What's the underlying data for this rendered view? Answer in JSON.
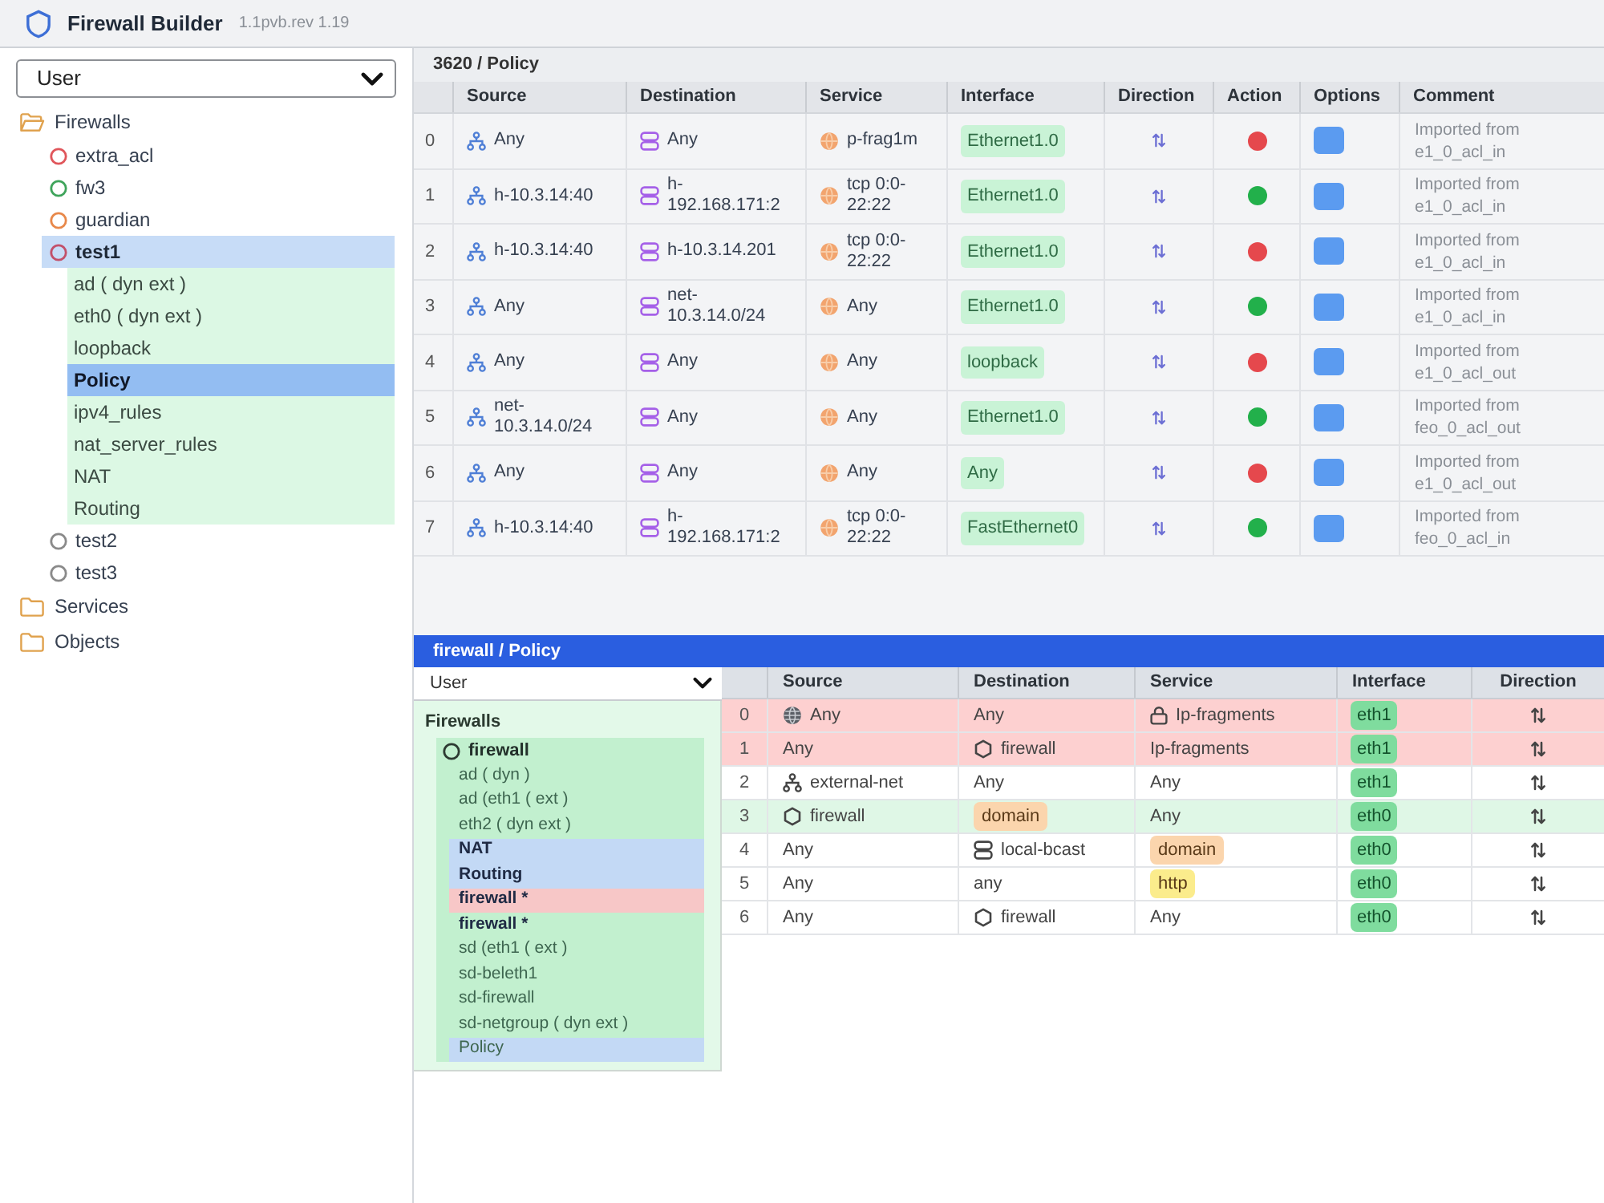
{
  "app": {
    "title": "Firewall Builder",
    "version": "1.1pvb.rev 1.19"
  },
  "sidebar": {
    "library": "User",
    "tree": [
      {
        "label": "Firewalls",
        "expanded": true,
        "selected": false,
        "children": [
          {
            "label": "extra_acl",
            "color": "#e0565b",
            "selected": false
          },
          {
            "label": "fw3",
            "color": "#3fa45b",
            "selected": false
          },
          {
            "label": "guardian",
            "color": "#e8884a",
            "selected": false
          },
          {
            "label": "test1",
            "color": "#c2506a",
            "selected": true,
            "children": [
              {
                "label": "ad ( dyn ext )",
                "selected": false
              },
              {
                "label": "eth0 ( dyn ext )",
                "selected": false
              },
              {
                "label": "loopback",
                "selected": false
              },
              {
                "label": "Policy",
                "selected": true
              },
              {
                "label": "ipv4_rules",
                "selected": false
              },
              {
                "label": "nat_server_rules",
                "selected": false
              },
              {
                "label": "NAT",
                "selected": false
              },
              {
                "label": "Routing",
                "selected": false
              }
            ]
          },
          {
            "label": "test2",
            "color": "#8a8a8a",
            "selected": false
          },
          {
            "label": "test3",
            "color": "#8a8a8a",
            "selected": false
          }
        ]
      },
      {
        "label": "Services",
        "expanded": false,
        "selected": false
      },
      {
        "label": "Objects",
        "expanded": false,
        "selected": false
      }
    ]
  },
  "policy": {
    "title": "3620 / Policy",
    "columns": [
      "Source",
      "Destination",
      "Service",
      "Interface",
      "Direction",
      "Action",
      "Options",
      "Comment"
    ],
    "rows": [
      {
        "number": "0",
        "source": "Any",
        "destination": "Any",
        "service": "p-frag1m",
        "interface": "Ethernet1.0",
        "color": "#e5484d",
        "comment": "Imported from e1_0_acl_in"
      },
      {
        "number": "1",
        "source": "h-10.3.14:40",
        "destination": "h-192.168.171:2",
        "service": "tcp 0:0-22:22",
        "interface": "Ethernet1.0",
        "color": "#22b04b",
        "comment": "Imported from e1_0_acl_in"
      },
      {
        "number": "2",
        "source": "h-10.3.14:40",
        "destination": "h-10.3.14.201",
        "service": "tcp 0:0-22:22",
        "interface": "Ethernet1.0",
        "color": "#e5484d",
        "comment": "Imported from e1_0_acl_in"
      },
      {
        "number": "3",
        "source": "Any",
        "destination": "net-10.3.14.0/24",
        "service": "Any",
        "interface": "Ethernet1.0",
        "color": "#22b04b",
        "comment": "Imported from e1_0_acl_in"
      },
      {
        "number": "4",
        "source": "Any",
        "destination": "Any",
        "service": "Any",
        "interface": "loopback",
        "color": "#e5484d",
        "comment": "Imported from e1_0_acl_out"
      },
      {
        "number": "5",
        "source": "net-10.3.14.0/24",
        "destination": "Any",
        "service": "Any",
        "interface": "Ethernet1.0",
        "color": "#22b04b",
        "comment": "Imported from feo_0_acl_out"
      },
      {
        "number": "6",
        "source": "Any",
        "destination": "Any",
        "service": "Any",
        "interface": "Any",
        "color": "#e5484d",
        "comment": "Imported from e1_0_acl_out"
      },
      {
        "number": "7",
        "source": "h-10.3.14:40",
        "destination": "h-192.168.171:2",
        "service": "tcp 0:0-22:22",
        "interface": "FastEthernet0",
        "color": "#22b04b",
        "comment": "Imported from feo_0_acl_in"
      }
    ]
  },
  "lower_panel": {
    "title": "firewall / Policy",
    "library": "User",
    "tree": {
      "heading": "Firewalls",
      "firewall": "firewall",
      "children": [
        {
          "label": "ad ( dyn )",
          "bold": false
        },
        {
          "label": "ad (eth1 ( ext )",
          "bold": false
        },
        {
          "label": "eth2 ( dyn ext )",
          "bold": false
        },
        {
          "label": "NAT",
          "bold": true,
          "color": "#c3d9f5"
        },
        {
          "label": "Routing",
          "bold": true,
          "color": "#c3d9f5"
        },
        {
          "label": "firewall *",
          "bold": true,
          "color": "#f7c7c7"
        },
        {
          "label": "firewall *",
          "bold": true
        },
        {
          "label": "sd (eth1 ( ext )",
          "bold": false
        },
        {
          "label": "sd-beleth1",
          "bold": false
        },
        {
          "label": "sd-firewall",
          "bold": false
        },
        {
          "label": "sd-netgroup ( dyn ext )",
          "bold": false
        },
        {
          "label": "Policy",
          "bold": false,
          "color": "#c3d9f5"
        }
      ]
    }
  },
  "rules": {
    "columns": [
      "Source",
      "Destination",
      "Service",
      "Interface",
      "Direction"
    ],
    "rows": [
      {
        "number": "0",
        "color": "#fdd0d0",
        "source": {
          "kind": "globe",
          "text": "Any"
        },
        "destination": {
          "kind": "text",
          "text": "Any"
        },
        "service": {
          "kind": "lock",
          "text": "Ip-fragments"
        },
        "interface": "eth1"
      },
      {
        "number": "1",
        "color": "#fdd0d0",
        "source": {
          "kind": "text",
          "text": "Any"
        },
        "destination": {
          "kind": "firewall",
          "text": "firewall"
        },
        "service": {
          "kind": "text",
          "text": "Ip-fragments"
        },
        "interface": "eth1"
      },
      {
        "number": "2",
        "color": "#ffffff",
        "source": {
          "kind": "network",
          "text": "external-net"
        },
        "destination": {
          "kind": "text",
          "text": "Any"
        },
        "service": {
          "kind": "text",
          "text": "Any"
        },
        "interface": "eth1"
      },
      {
        "number": "3",
        "color": "#dff7e6",
        "source": {
          "kind": "firewall",
          "text": "firewall"
        },
        "destination": {
          "kind": "tag",
          "text": "domain",
          "color": "#fbd5ad"
        },
        "service": {
          "kind": "text",
          "text": "Any"
        },
        "interface": "eth0"
      },
      {
        "number": "4",
        "color": "#ffffff",
        "source": {
          "kind": "text",
          "text": "Any"
        },
        "destination": {
          "kind": "host",
          "text": "local-bcast"
        },
        "service": {
          "kind": "tag",
          "text": "domain",
          "color": "#fbd5ad"
        },
        "interface": "eth0"
      },
      {
        "number": "5",
        "color": "#ffffff",
        "source": {
          "kind": "text",
          "text": "Any"
        },
        "destination": {
          "kind": "text",
          "text": "any"
        },
        "service": {
          "kind": "tag",
          "text": "http",
          "color": "#fbec8c"
        },
        "interface": "eth0"
      },
      {
        "number": "6",
        "color": "#ffffff",
        "source": {
          "kind": "text",
          "text": "Any"
        },
        "destination": {
          "kind": "firewall",
          "text": "firewall"
        },
        "service": {
          "kind": "text",
          "text": "Any"
        },
        "interface": "eth0"
      }
    ]
  }
}
